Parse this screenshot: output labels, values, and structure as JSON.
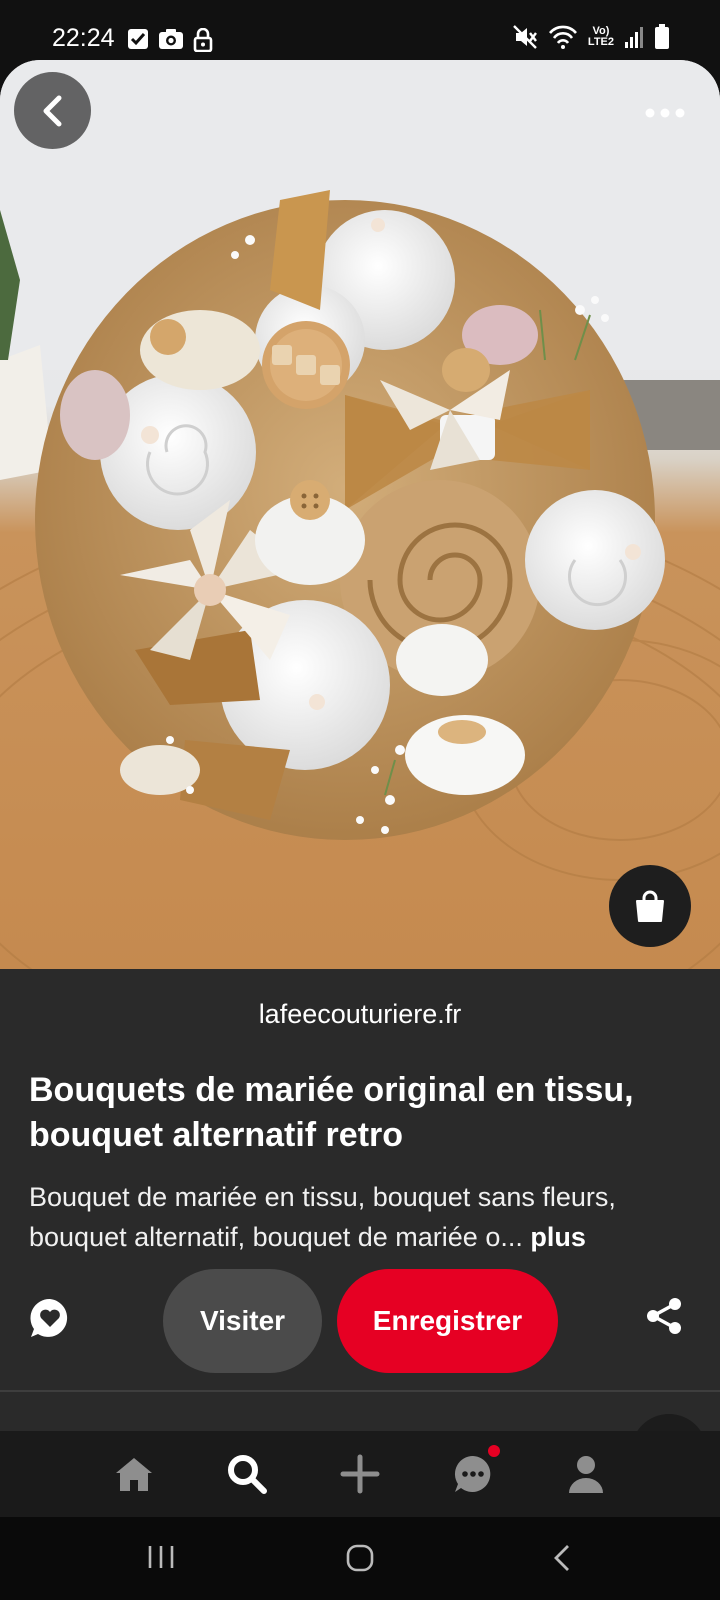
{
  "status_bar": {
    "time": "22:24",
    "left_icons": [
      "checkbox-icon",
      "camera-icon",
      "lock-icon"
    ],
    "right_icons": [
      "mute-icon",
      "wifi-call-icon",
      "volte-lte2-icon",
      "signal-icon",
      "battery-icon"
    ],
    "network_label_top": "Vo)",
    "network_label_bottom": "LTE2"
  },
  "pin": {
    "image_alt": "Bouquet de mariée en tissu sur table en bois",
    "source_domain": "lafeecouturiere.fr",
    "title": "Bouquets de mariée original en tissu, bouquet alternatif retro",
    "description": "Bouquet de mariée en tissu, bouquet sans fleurs, bouquet alternatif, bouquet de mariée o...",
    "more_label": "plus",
    "visit_label": "Visiter",
    "save_label": "Enregistrer"
  },
  "toolbar_icons": {
    "back": "chevron-left-icon",
    "more": "more-horizontal-icon",
    "shop": "shopping-bag-icon",
    "comment": "comment-heart-icon",
    "share": "share-icon"
  },
  "bottom_nav": {
    "items": [
      "home-icon",
      "search-icon",
      "create-icon",
      "messages-icon",
      "profile-icon"
    ],
    "active": "search-icon",
    "messages_has_notification": true
  },
  "colors": {
    "accent": "#e60023",
    "panel": "#2a2a2a",
    "secondary_button": "#4b4b4b"
  }
}
